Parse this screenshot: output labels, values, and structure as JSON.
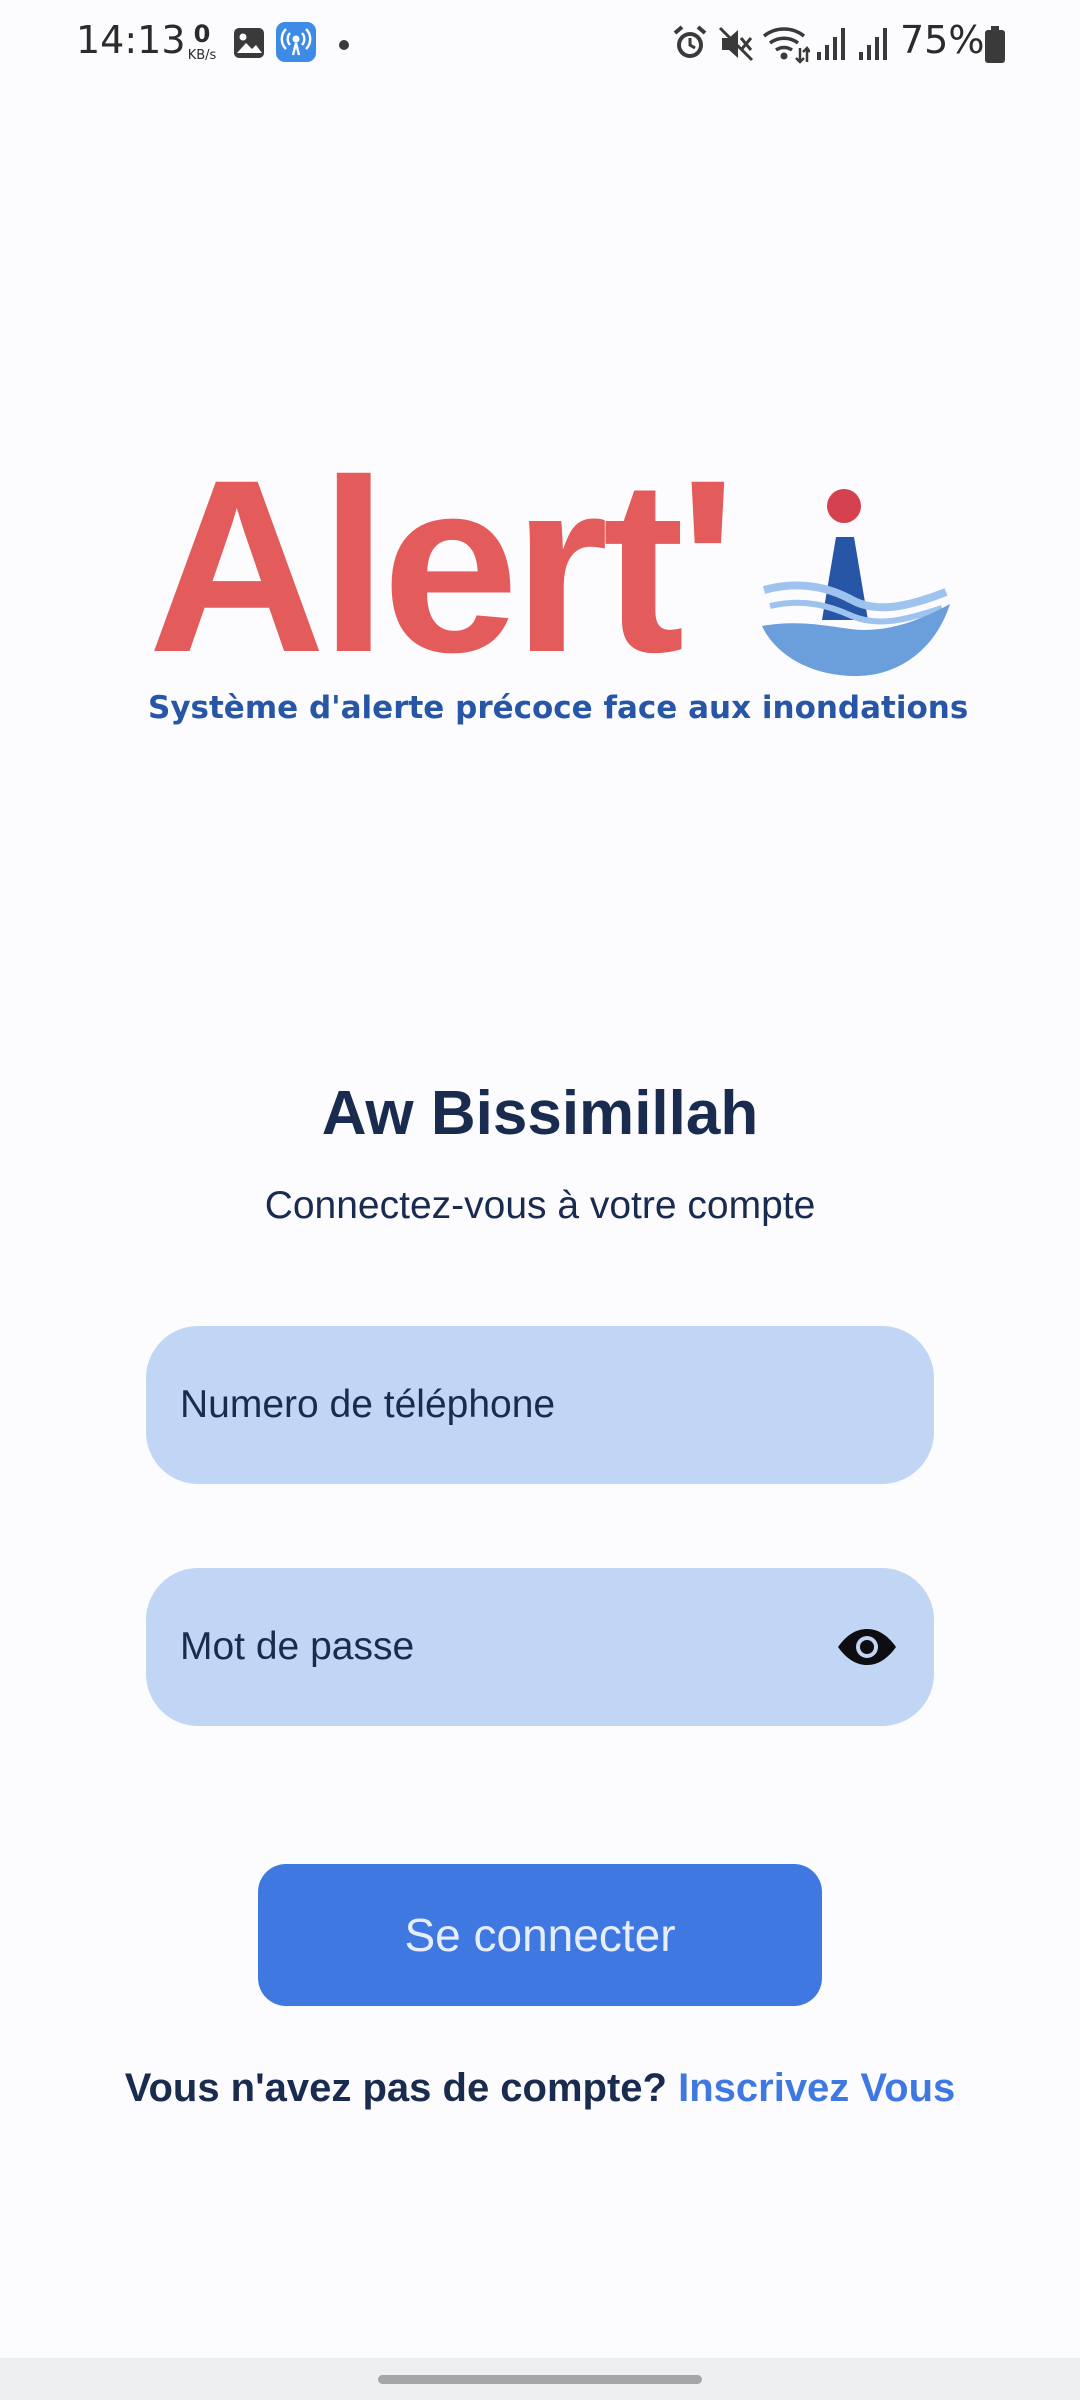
{
  "status_bar": {
    "time": "14:13",
    "net_speed_value": "0",
    "net_speed_unit": "KB/s",
    "battery": "75%",
    "left_icons": [
      "image-icon",
      "hotspot-icon",
      "notification-dot-icon"
    ],
    "right_icons": [
      "alarm-icon",
      "mute-icon",
      "wifi-icon",
      "signal-icon",
      "signal-icon",
      "battery-icon"
    ]
  },
  "logo": {
    "word": "Alert'",
    "tagline": "Système d'alerte précoce face aux inondations",
    "colors": {
      "word": "#e35b5a",
      "dot": "#d6414f",
      "pillar": "#2756a6",
      "water": "#6a9fdc"
    }
  },
  "welcome": {
    "title": "Aw Bissimillah",
    "subtitle": "Connectez-vous à votre compte"
  },
  "form": {
    "phone_placeholder": "Numero de téléphone",
    "password_placeholder": "Mot de passe",
    "password_toggle_icon": "eye-icon",
    "submit_label": "Se connecter"
  },
  "signup": {
    "prompt": "Vous n'avez pas de compte?",
    "link": "Inscrivez Vous"
  },
  "colors": {
    "primary": "#3f78e0",
    "field_bg": "#c1d6f4",
    "text_dark": "#1a2b50"
  }
}
